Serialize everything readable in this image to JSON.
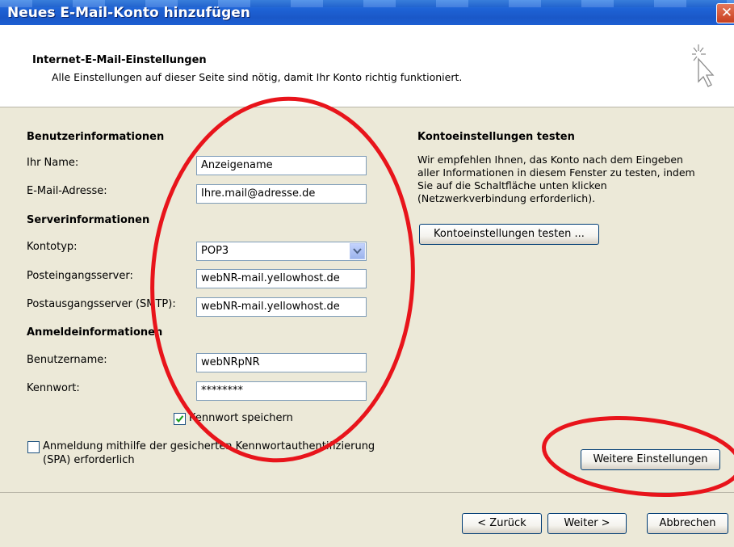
{
  "window": {
    "title": "Neues E-Mail-Konto hinzufügen",
    "close_label": "✕"
  },
  "header": {
    "title": "Internet-E-Mail-Einstellungen",
    "subtitle": "Alle Einstellungen auf dieser Seite sind nötig, damit Ihr Konto richtig funktioniert.",
    "icon": "cursor-sparkle-icon"
  },
  "user_info": {
    "heading": "Benutzerinformationen",
    "name_label": "Ihr Name:",
    "name_value": "Anzeigename",
    "email_label": "E-Mail-Adresse:",
    "email_value": "Ihre.mail@adresse.de"
  },
  "server_info": {
    "heading": "Serverinformationen",
    "account_type_label": "Kontotyp:",
    "account_type_value": "POP3",
    "incoming_label": "Posteingangsserver:",
    "incoming_value": "webNR-mail.yellowhost.de",
    "outgoing_label": "Postausgangsserver (SMTP):",
    "outgoing_value": "webNR-mail.yellowhost.de"
  },
  "login_info": {
    "heading": "Anmeldeinformationen",
    "username_label": "Benutzername:",
    "username_value": "webNRpNR",
    "password_label": "Kennwort:",
    "password_value": "********",
    "remember_label": "Kennwort speichern",
    "remember_checked": true,
    "spa_label_line1": "Anmeldung mithilfe der gesicherten Kennwortauthentifizierung",
    "spa_label_line2": "(SPA) erforderlich",
    "spa_checked": false
  },
  "test_panel": {
    "heading": "Kontoeinstellungen testen",
    "text_line1": "Wir empfehlen Ihnen, das Konto nach dem Eingeben",
    "text_line2": "aller Informationen in diesem Fenster zu testen, indem",
    "text_line3": "Sie auf die Schaltfläche unten klicken",
    "text_line4": "(Netzwerkverbindung erforderlich).",
    "test_button": "Kontoeinstellungen testen ..."
  },
  "more_settings_button": "Weitere Einstellungen",
  "footer": {
    "back_button": "< Zurück",
    "next_button": "Weiter >",
    "cancel_button": "Abbrechen"
  },
  "colors": {
    "titlebar": "#1e63d6",
    "dialog_bg": "#ece9d8",
    "annotation_red": "#e8141b"
  }
}
